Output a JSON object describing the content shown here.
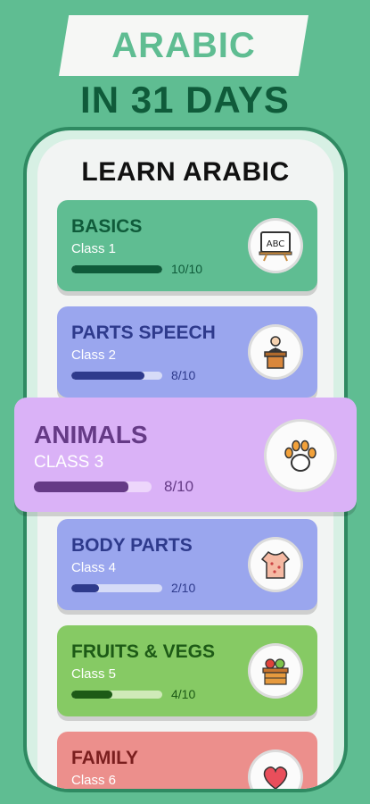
{
  "headline": {
    "banner_text": "ARABIC",
    "sub_text": "IN 31 DAYS"
  },
  "app": {
    "title": "LEARN ARABIC"
  },
  "lessons": [
    {
      "name": "BASICS",
      "class_label": "Class 1",
      "progress_text": "10/10",
      "progress": 1.0,
      "colors": {
        "bg": "#5fbd92",
        "fill": "#0f5b3a",
        "track": "#c9ead9",
        "text": "#0f5b3a",
        "sub": "#ffffff"
      },
      "icon": "abc-board-icon"
    },
    {
      "name": "PARTS SPEECH",
      "class_label": "Class 2",
      "progress_text": "8/10",
      "progress": 0.8,
      "colors": {
        "bg": "#9aa6ee",
        "fill": "#2e3a8c",
        "track": "#d6dbf7",
        "text": "#2e3a8c",
        "sub": "#ffffff"
      },
      "icon": "podium-speaker-icon"
    },
    {
      "name": "ANIMALS",
      "class_label": "CLASS 3",
      "progress_text": "8/10",
      "progress": 0.8,
      "colors": {
        "bg": "#dab2f7",
        "fill": "#653a86",
        "track": "#edd6fb",
        "text": "#653a86",
        "sub": "#ffffff"
      },
      "icon": "paw-icon"
    },
    {
      "name": "BODY PARTS",
      "class_label": "Class 4",
      "progress_text": "2/10",
      "progress": 0.3,
      "colors": {
        "bg": "#9aa6ee",
        "fill": "#2e3a8c",
        "track": "#d6dbf7",
        "text": "#2e3a8c",
        "sub": "#ffffff"
      },
      "icon": "body-torso-icon"
    },
    {
      "name": "FRUITS & VEGS",
      "class_label": "Class 5",
      "progress_text": "4/10",
      "progress": 0.45,
      "colors": {
        "bg": "#86ca64",
        "fill": "#1d5a16",
        "track": "#cfeab8",
        "text": "#1d5a16",
        "sub": "#ffffff"
      },
      "icon": "fruit-basket-icon"
    },
    {
      "name": "FAMILY",
      "class_label": "Class 6",
      "progress_text": "",
      "progress": 0,
      "colors": {
        "bg": "#ec8f8c",
        "fill": "#7a1e1e",
        "track": "#f6c9c7",
        "text": "#7a1e1e",
        "sub": "#ffffff"
      },
      "icon": "heart-family-icon"
    }
  ]
}
